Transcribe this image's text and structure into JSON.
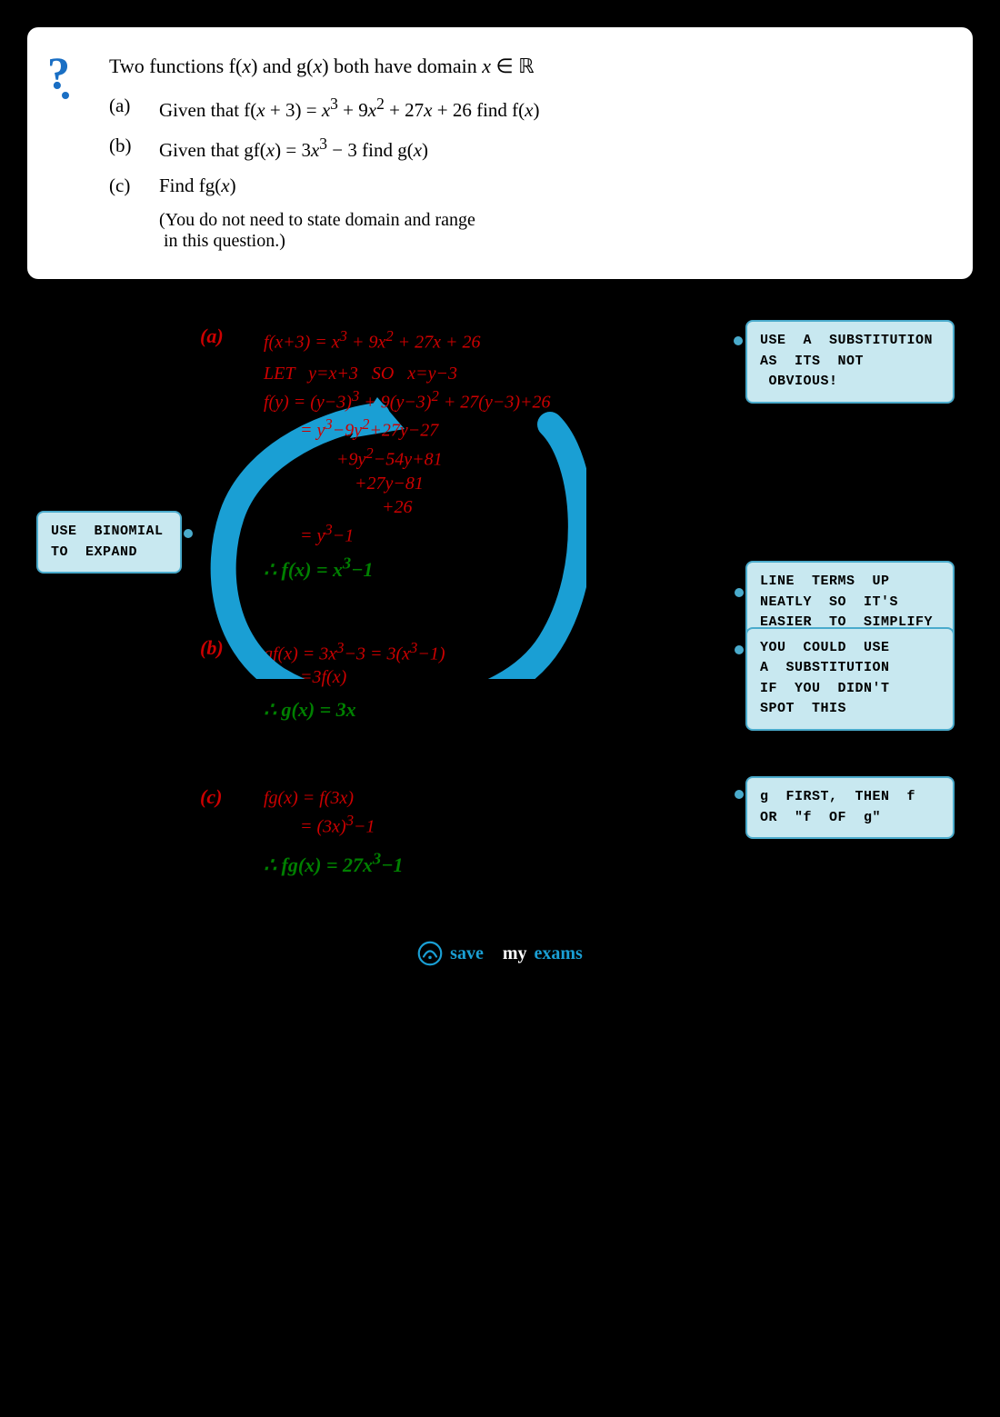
{
  "question": {
    "title": "Two functions f(x) and g(x) both have domain x ∈ ℝ",
    "parts": [
      {
        "label": "(a)",
        "text": "Given that f(x + 3) = x³ + 9x² + 27x + 26 find f(x)"
      },
      {
        "label": "(b)",
        "text": "Given that gf(x) = 3x³ − 3 find g(x)"
      },
      {
        "label": "(c)",
        "text": "Find fg(x)"
      }
    ],
    "note": "(You do not need to state domain and range in this question.)"
  },
  "solution": {
    "part_a": {
      "label": "(a)",
      "lines": [
        "f(x+3) = x³ + 9x² + 27x + 26",
        "LET  y=x+3  SO  x=y−3",
        "f(y) = (y−3)³ + 9(y−3)² + 27(y−3)+26",
        "= y³−9y²+27y−27",
        "+9y²−54y+81",
        "+27y−81",
        "+26",
        "= y³−1",
        "∴ f(x) = x³−1"
      ],
      "annotations": {
        "use_substitution": "USE  A  SUBSTITUTION\nAS  ITS  NOT  OBVIOUS!",
        "use_binomial": "USE  BINOMIAL\nTO  EXPAND",
        "line_terms": "LINE  TERMS  UP\nNEATLY  SO  IT'S\nEASIER  TO  SIMPLIFY"
      }
    },
    "part_b": {
      "label": "(b)",
      "lines": [
        "gf(x) = 3x³−3 = 3(x³−1)",
        "=3f(x)",
        "∴ g(x) = 3x"
      ],
      "annotation": "YOU  COULD  USE\nA  SUBSTITUTION\nIF  YOU  DIDN'T\nSPOT  THIS"
    },
    "part_c": {
      "label": "(c)",
      "lines": [
        "fg(x) = f(3x)",
        "= (3x)³−1",
        "∴ fg(x) = 27x³−1"
      ],
      "annotation": "g  FIRST,  THEN  f\nOR  \"f  OF  g\""
    }
  },
  "footer": {
    "brand": "save my exams",
    "save_text": "save",
    "my_text": "my",
    "exams_text": "exams"
  }
}
